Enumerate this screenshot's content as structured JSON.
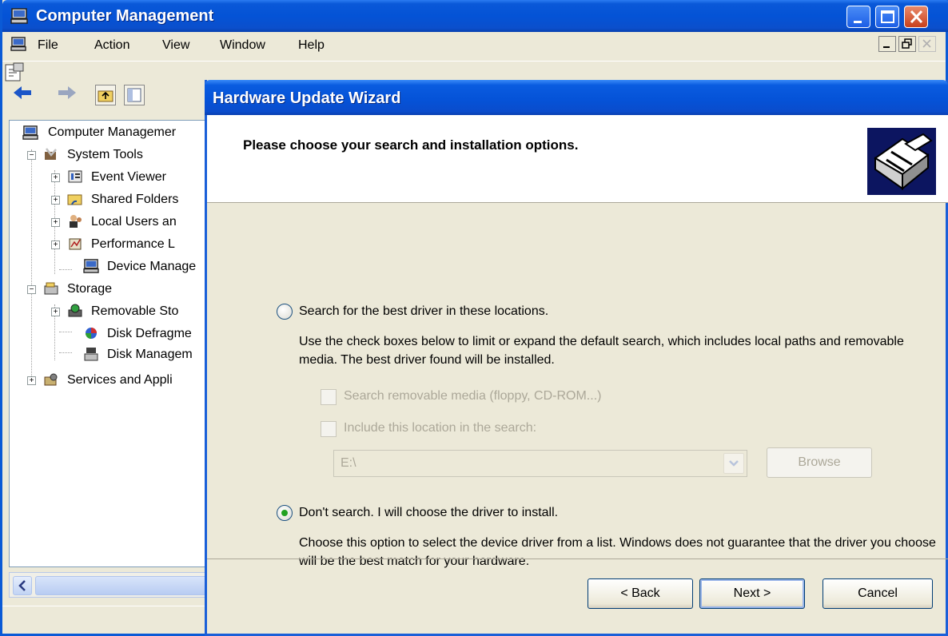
{
  "main_window": {
    "title": "Computer Management",
    "menu": [
      "File",
      "Action",
      "View",
      "Window",
      "Help"
    ]
  },
  "tree": {
    "items": [
      {
        "label": "Computer Managemer",
        "level": 0
      },
      {
        "label": "System Tools",
        "level": 1
      },
      {
        "label": "Event Viewer",
        "level": 2
      },
      {
        "label": "Shared Folders",
        "level": 2
      },
      {
        "label": "Local Users an",
        "level": 2
      },
      {
        "label": "Performance L",
        "level": 2
      },
      {
        "label": "Device Manage",
        "level": 2
      },
      {
        "label": "Storage",
        "level": 1
      },
      {
        "label": "Removable Sto",
        "level": 2
      },
      {
        "label": "Disk Defragme",
        "level": 2
      },
      {
        "label": "Disk Managem",
        "level": 2
      },
      {
        "label": "Services and Appli",
        "level": 1
      }
    ]
  },
  "wizard": {
    "title": "Hardware Update Wizard",
    "heading": "Please choose your search and installation options.",
    "option_search": {
      "label": "Search for the best driver in these locations.",
      "selected": false,
      "description": "Use the check boxes below to limit or expand the default search, which includes local paths and removable media. The best driver found will be installed."
    },
    "check_removable": {
      "label": "Search removable media (floppy, CD-ROM...)",
      "checked": false,
      "enabled": false
    },
    "check_location": {
      "label": "Include this location in the search:",
      "checked": false,
      "enabled": false
    },
    "location_value": "E:\\",
    "browse_label": "Browse",
    "option_manual": {
      "label": "Don't search. I will choose the driver to install.",
      "selected": true,
      "description": "Choose this option to select the device driver from a list.  Windows does not guarantee that the driver you choose will be the best match for your hardware."
    },
    "buttons": {
      "back": "< Back",
      "next": "Next >",
      "cancel": "Cancel"
    }
  }
}
